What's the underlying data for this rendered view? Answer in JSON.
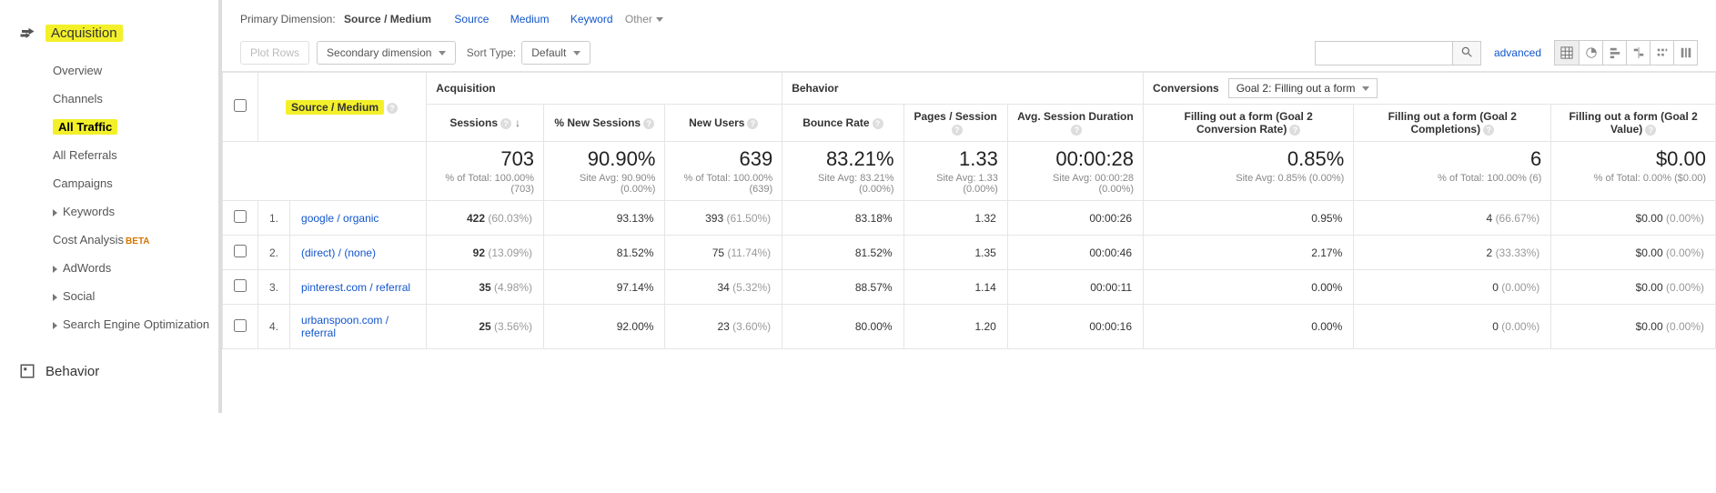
{
  "sidebar": {
    "section1": {
      "label": "Acquisition",
      "items": [
        {
          "label": "Overview"
        },
        {
          "label": "Channels"
        },
        {
          "label": "All Traffic",
          "active": true,
          "highlight": true
        },
        {
          "label": "All Referrals"
        },
        {
          "label": "Campaigns"
        },
        {
          "label": "Keywords",
          "expandable": true
        },
        {
          "label": "Cost Analysis",
          "beta": "BETA"
        },
        {
          "label": "AdWords",
          "expandable": true
        },
        {
          "label": "Social",
          "expandable": true
        },
        {
          "label": "Search Engine Optimization",
          "expandable": true
        }
      ]
    },
    "section2": {
      "label": "Behavior"
    }
  },
  "dimbar": {
    "label": "Primary Dimension:",
    "selected": "Source / Medium",
    "links": [
      "Source",
      "Medium",
      "Keyword"
    ],
    "other": "Other"
  },
  "controls": {
    "plot": "Plot Rows",
    "secondary": "Secondary dimension",
    "sortType": "Sort Type:",
    "sortVal": "Default",
    "advanced": "advanced"
  },
  "groups": {
    "acq": "Acquisition",
    "beh": "Behavior",
    "conv": "Conversions",
    "convSel": "Goal 2: Filling out a form"
  },
  "dimHeader": "Source / Medium",
  "cols": {
    "sessions": "Sessions",
    "newSess": "% New Sessions",
    "newUsers": "New Users",
    "bounce": "Bounce Rate",
    "pages": "Pages / Session",
    "dur": "Avg. Session Duration",
    "g2rate": "Filling out a form (Goal 2 Conversion Rate)",
    "g2comp": "Filling out a form (Goal 2 Completions)",
    "g2val": "Filling out a form (Goal 2 Value)"
  },
  "totals": {
    "sessions": {
      "big": "703",
      "sub": "% of Total: 100.00% (703)"
    },
    "newSess": {
      "big": "90.90%",
      "sub": "Site Avg: 90.90% (0.00%)"
    },
    "newUsers": {
      "big": "639",
      "sub": "% of Total: 100.00% (639)"
    },
    "bounce": {
      "big": "83.21%",
      "sub": "Site Avg: 83.21% (0.00%)"
    },
    "pages": {
      "big": "1.33",
      "sub": "Site Avg: 1.33 (0.00%)"
    },
    "dur": {
      "big": "00:00:28",
      "sub": "Site Avg: 00:00:28 (0.00%)"
    },
    "g2rate": {
      "big": "0.85%",
      "sub": "Site Avg: 0.85% (0.00%)"
    },
    "g2comp": {
      "big": "6",
      "sub": "% of Total: 100.00% (6)"
    },
    "g2val": {
      "big": "$0.00",
      "sub": "% of Total: 0.00% ($0.00)"
    }
  },
  "rows": [
    {
      "n": "1.",
      "src": "google / organic",
      "sess": "422",
      "sessP": "(60.03%)",
      "newP": "93.13%",
      "nu": "393",
      "nuP": "(61.50%)",
      "br": "83.18%",
      "pg": "1.32",
      "dur": "00:00:26",
      "cr": "0.95%",
      "cc": "4",
      "ccP": "(66.67%)",
      "cv": "$0.00",
      "cvP": "(0.00%)"
    },
    {
      "n": "2.",
      "src": "(direct) / (none)",
      "sess": "92",
      "sessP": "(13.09%)",
      "newP": "81.52%",
      "nu": "75",
      "nuP": "(11.74%)",
      "br": "81.52%",
      "pg": "1.35",
      "dur": "00:00:46",
      "cr": "2.17%",
      "cc": "2",
      "ccP": "(33.33%)",
      "cv": "$0.00",
      "cvP": "(0.00%)"
    },
    {
      "n": "3.",
      "src": "pinterest.com / referral",
      "sess": "35",
      "sessP": "(4.98%)",
      "newP": "97.14%",
      "nu": "34",
      "nuP": "(5.32%)",
      "br": "88.57%",
      "pg": "1.14",
      "dur": "00:00:11",
      "cr": "0.00%",
      "cc": "0",
      "ccP": "(0.00%)",
      "cv": "$0.00",
      "cvP": "(0.00%)"
    },
    {
      "n": "4.",
      "src": "urbanspoon.com / referral",
      "sess": "25",
      "sessP": "(3.56%)",
      "newP": "92.00%",
      "nu": "23",
      "nuP": "(3.60%)",
      "br": "80.00%",
      "pg": "1.20",
      "dur": "00:00:16",
      "cr": "0.00%",
      "cc": "0",
      "ccP": "(0.00%)",
      "cv": "$0.00",
      "cvP": "(0.00%)"
    }
  ]
}
